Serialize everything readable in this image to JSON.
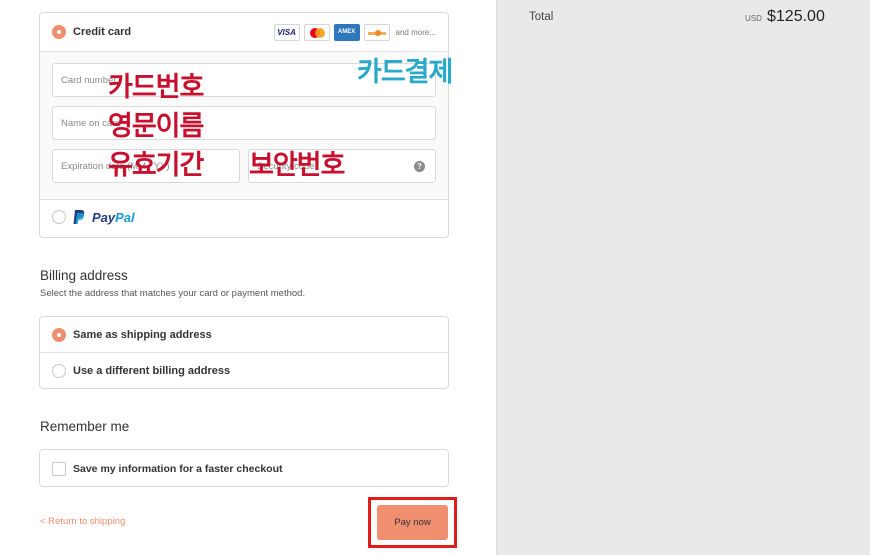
{
  "payment": {
    "credit_card_label": "Credit card",
    "card_logos": [
      "VISA",
      "mastercard",
      "AMEX",
      "discover"
    ],
    "card_logos_more": "and more...",
    "card_number_placeholder": "Card number",
    "name_on_card_placeholder": "Name on card",
    "expiration_placeholder": "Expiration date (MM / YY)",
    "security_code_placeholder": "Security code",
    "paypal_label_a": "Pay",
    "paypal_label_b": "Pal"
  },
  "annotations": {
    "card_payment": "카드결제",
    "card_number": "카드번호",
    "english_name": "영문이름",
    "expiry": "유효기간",
    "security_code": "보안번호"
  },
  "billing": {
    "title": "Billing address",
    "subtitle": "Select the address that matches your card or payment method.",
    "same_as_shipping": "Same as shipping address",
    "different_address": "Use a different billing address"
  },
  "remember": {
    "title": "Remember me",
    "save_info": "Save my information for a faster checkout"
  },
  "footer": {
    "back_link": "< Return to shipping",
    "pay_button": "Pay now"
  },
  "summary": {
    "total_label": "Total",
    "currency": "USD",
    "total_value": "$125.00"
  },
  "colors": {
    "accent": "#ef8f6f",
    "highlight_border": "#e31b1b",
    "annotation_red": "#c8102e",
    "annotation_blue": "#29a9c9",
    "summary_bg": "#e9e9e9"
  }
}
